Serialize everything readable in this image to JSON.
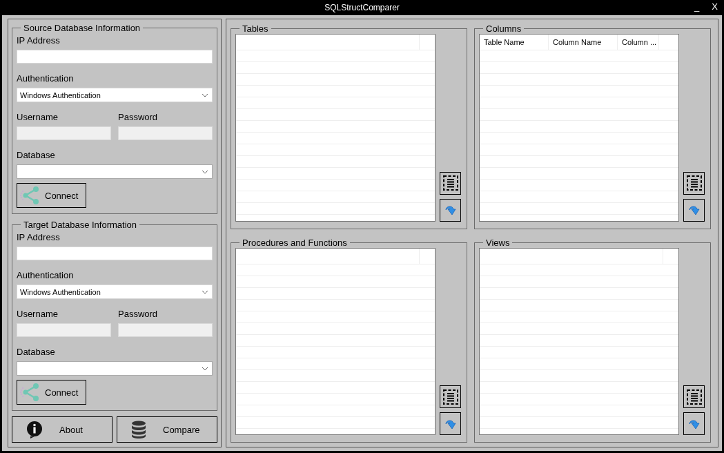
{
  "window": {
    "title": "SQLStructComparer",
    "minimize": "_",
    "close": "X"
  },
  "databases": [
    {
      "title": "Source Database Information",
      "ip_label": "IP Address",
      "auth_label": "Authentication",
      "auth_value": "Windows Authentication",
      "username_label": "Username",
      "password_label": "Password",
      "credentials_disabled": true,
      "database_label": "Database",
      "connect": "Connect"
    },
    {
      "title": "Target Database Information",
      "ip_label": "IP Address",
      "auth_label": "Authentication",
      "auth_value": "Windows Authentication",
      "username_label": "Username",
      "password_label": "Password",
      "credentials_disabled": true,
      "database_label": "Database",
      "connect": "Connect"
    }
  ],
  "buttons": [
    {
      "kind": "info",
      "label": "About"
    },
    {
      "kind": "database",
      "label": "Compare"
    }
  ],
  "lists": [
    {
      "title": "Tables"
    },
    {
      "title": "Columns",
      "columns": [
        "Table Name",
        "Column Name",
        "Column ..."
      ]
    },
    {
      "title": "Procedures and Functions"
    },
    {
      "title": "Views"
    }
  ]
}
